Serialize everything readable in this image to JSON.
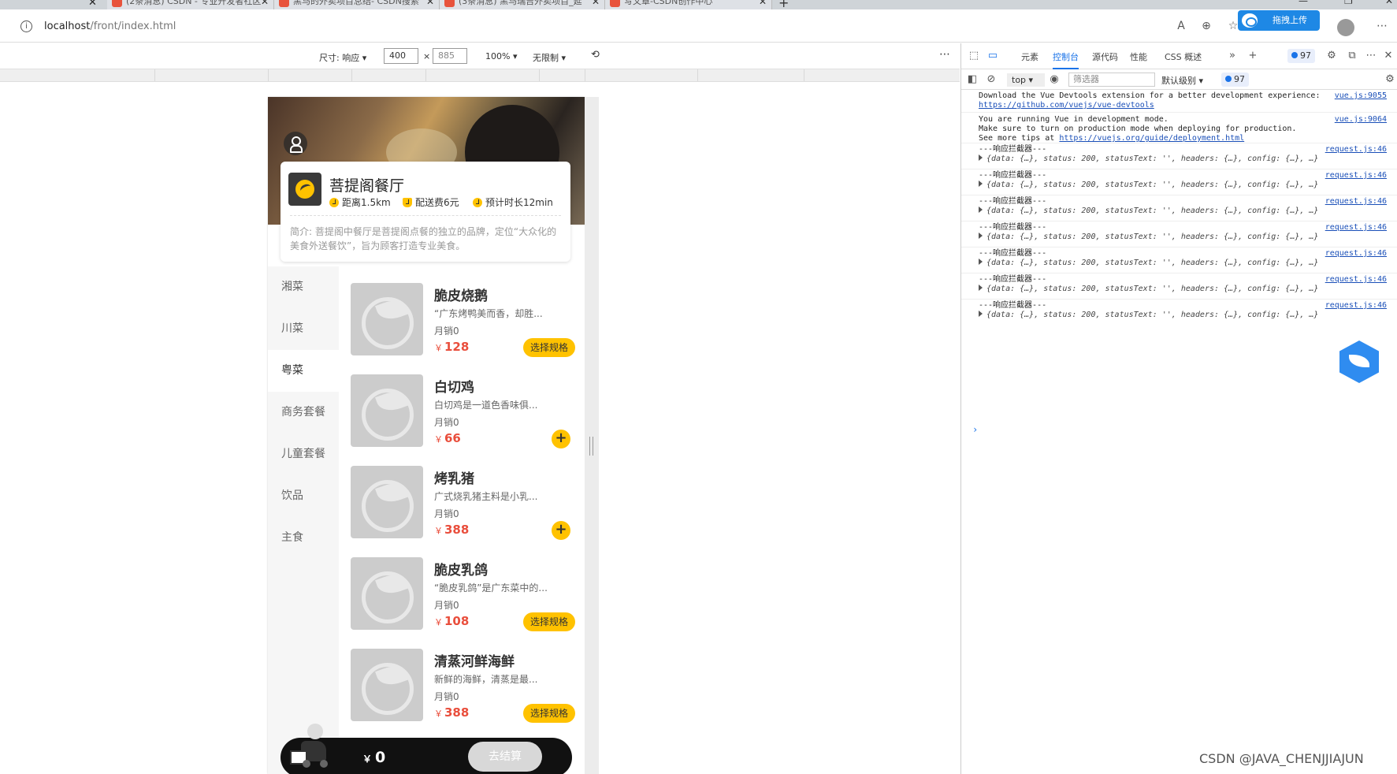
{
  "browser": {
    "tabs": [
      {
        "title": "(2条消息) CSDN - 专业开发者社区"
      },
      {
        "title": "黑马的外卖项目总结- CSDN搜索"
      },
      {
        "title": "(3条消息) 黑马瑞吉外卖项目_延"
      },
      {
        "title": "写文章-CSDN创作中心"
      }
    ],
    "url_host": "localhost",
    "url_path": "/front/index.html",
    "upload_label": "拖拽上传"
  },
  "device_toolbar": {
    "size_label": "尺寸: 响应",
    "width": "400",
    "height": "885",
    "times": "×",
    "zoom": "100%",
    "throttle": "无限制"
  },
  "app": {
    "shop": {
      "name": "菩提阁餐厅",
      "distance": "距离1.5km",
      "fee": "配送费6元",
      "eta": "预计时长12min",
      "intro": "简介: 菩提阁中餐厅是菩提阁点餐的独立的品牌，定位“大众化的美食外送餐饮”，旨为顾客打造专业美食。"
    },
    "categories": [
      "湘菜",
      "川菜",
      "粤菜",
      "商务套餐",
      "儿童套餐",
      "饮品",
      "主食"
    ],
    "active_category": "粤菜",
    "currency": "￥",
    "dishes": [
      {
        "name": "脆皮烧鹅",
        "desc": "“广东烤鸭美而香，却胜...",
        "sales": "月销0",
        "price": "128",
        "action": "选择规格"
      },
      {
        "name": "白切鸡",
        "desc": "白切鸡是一道色香味俱...",
        "sales": "月销0",
        "price": "66",
        "action": "+"
      },
      {
        "name": "烤乳猪",
        "desc": "广式烧乳猪主料是小乳...",
        "sales": "月销0",
        "price": "388",
        "action": "+"
      },
      {
        "name": "脆皮乳鸽",
        "desc": "“脆皮乳鸽”是广东菜中的...",
        "sales": "月销0",
        "price": "108",
        "action": "选择规格"
      },
      {
        "name": "清蒸河鲜海鲜",
        "desc": "新鲜的海鲜，清蒸是最...",
        "sales": "月销0",
        "price": "388",
        "action": "选择规格"
      }
    ],
    "cart": {
      "total": "0",
      "checkout": "去结算"
    }
  },
  "devtools": {
    "tabs": [
      "元素",
      "控制台",
      "源代码",
      "性能",
      "CSS 概述"
    ],
    "active_tab": "控制台",
    "issues_count": "97",
    "context": "top",
    "filter_placeholder": "筛选器",
    "level": "默认级别",
    "messages": [
      {
        "lines": [
          "Download the Vue Devtools extension for a better development experience:"
        ],
        "link": "https://github.com/vuejs/vue-devtools",
        "source": "vue.js:9055"
      },
      {
        "lines": [
          "You are running Vue in development mode.",
          "Make sure to turn on production mode when deploying for production."
        ],
        "prefix": "See more tips at ",
        "link": "https://vuejs.org/guide/deployment.html",
        "source": "vue.js:9064"
      }
    ],
    "log_label": "---响应拦截器---",
    "log_object": "{data: {…}, status: 200, statusText: '', headers: {…}, config: {…}, …}",
    "log_source": "request.js:46",
    "log_repeat": 7
  },
  "watermark": "CSDN @JAVA_CHENJJIAJUN"
}
